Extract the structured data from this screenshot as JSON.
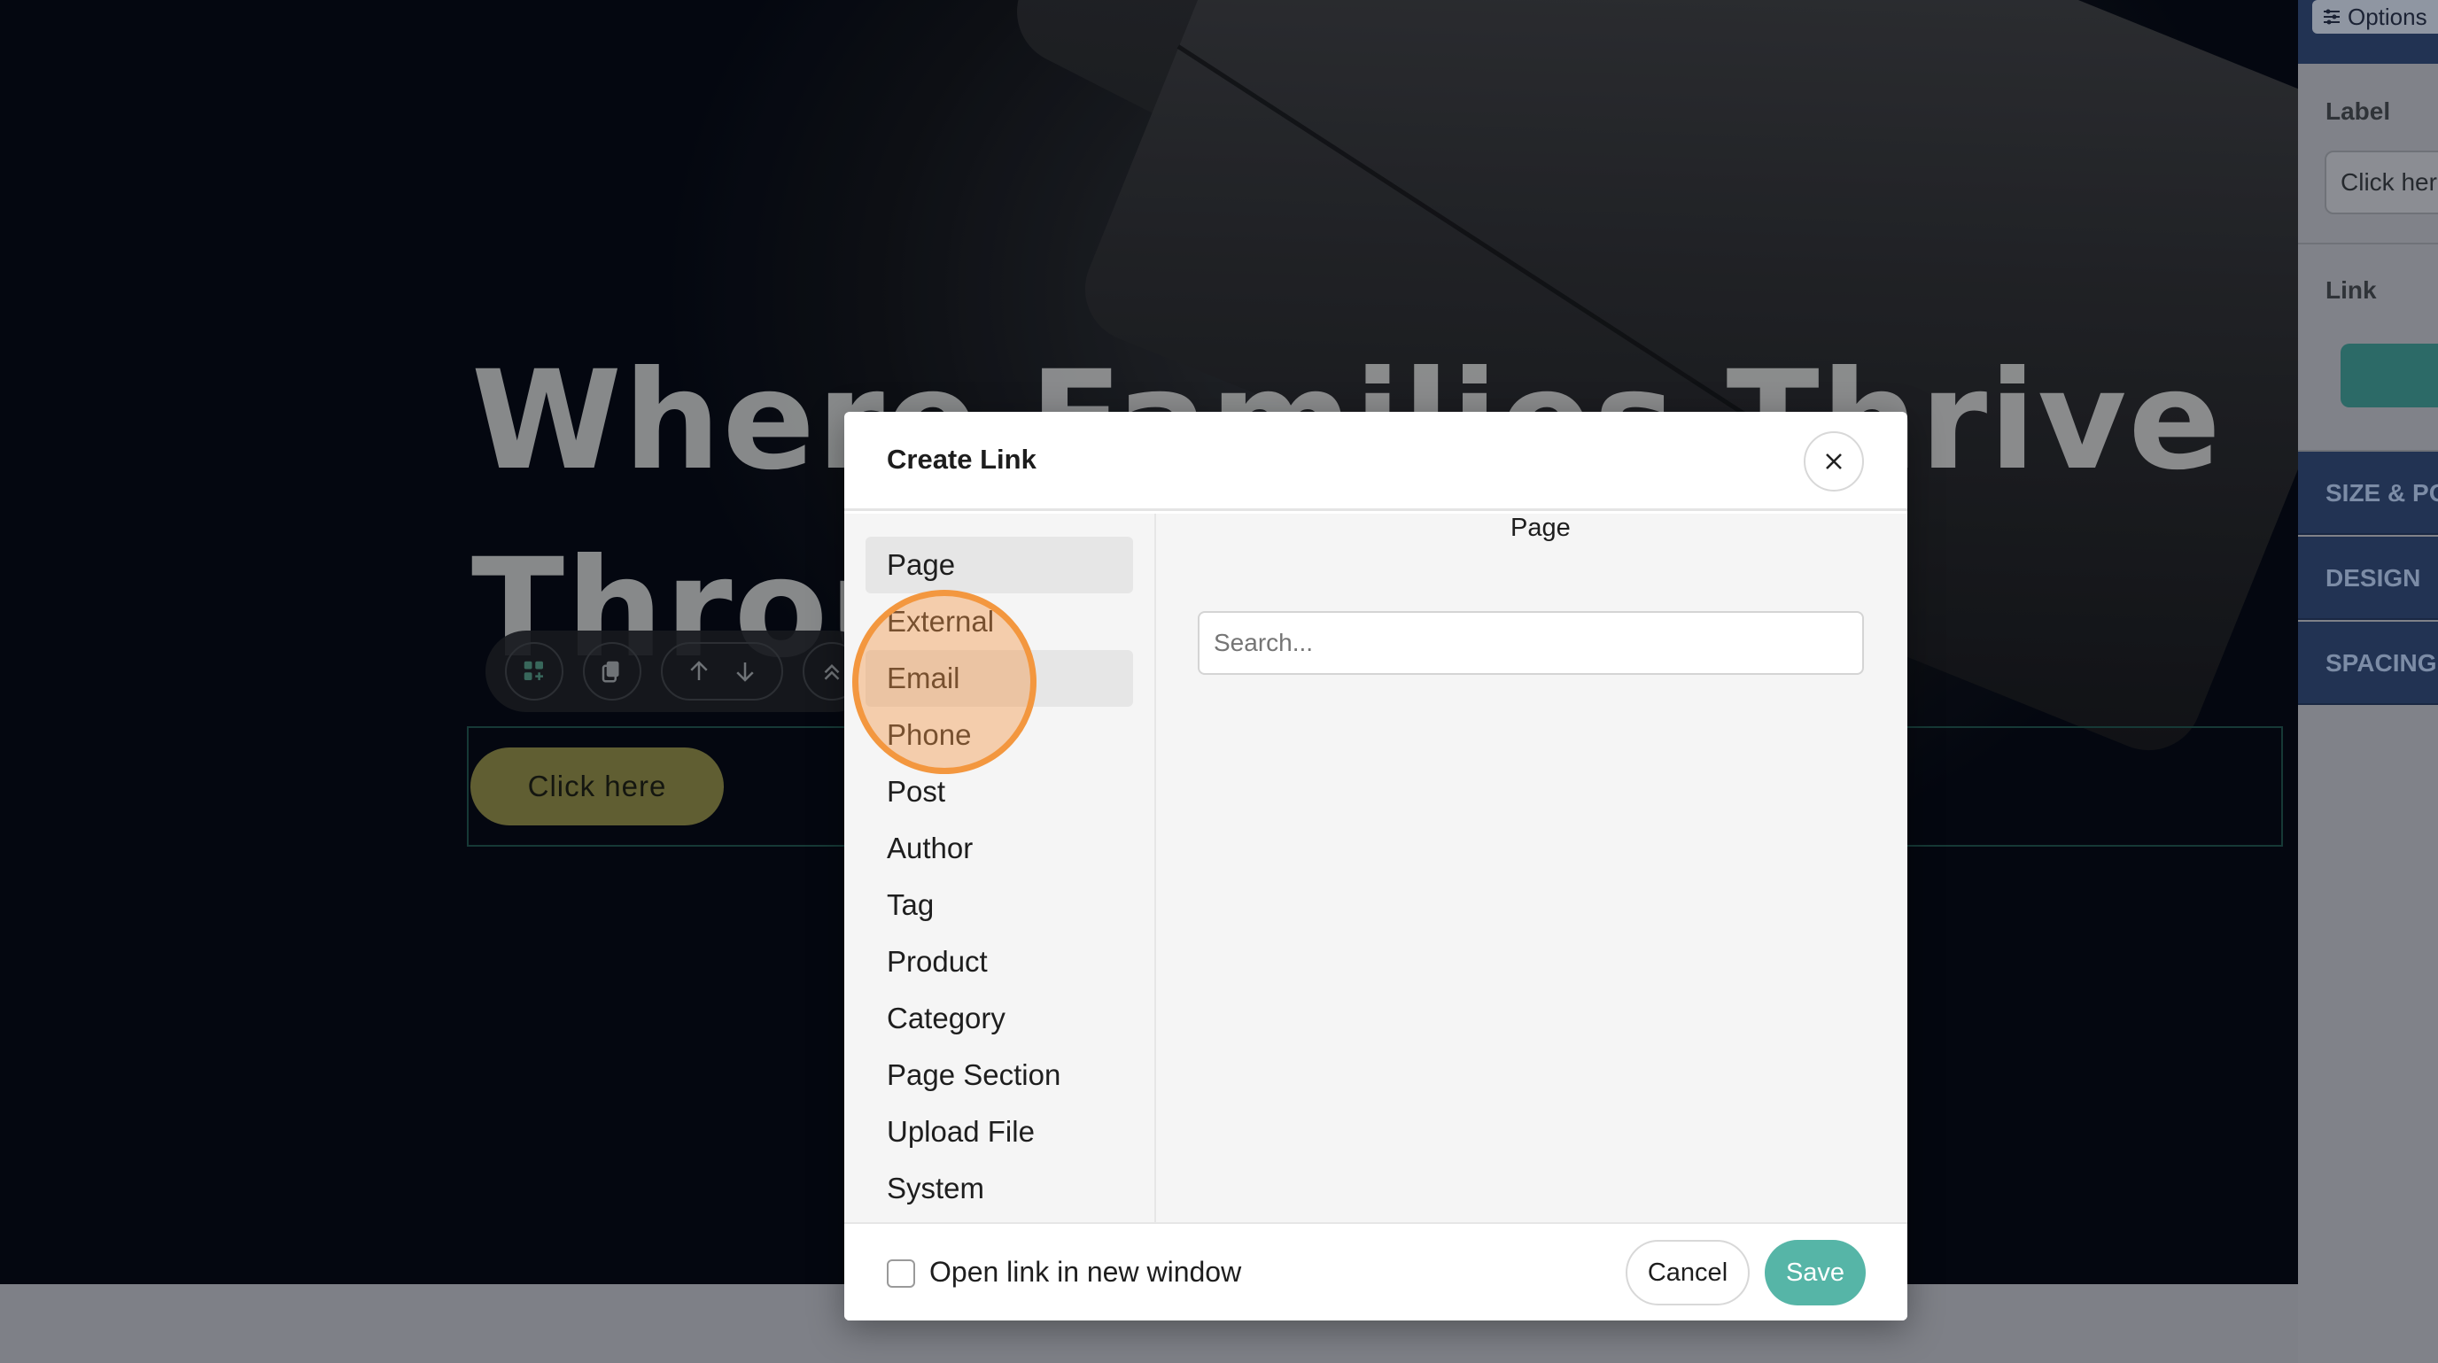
{
  "hero": {
    "title": "Where Families Thrive Through",
    "cta_label": "Click here"
  },
  "inspector": {
    "options_label": "Options",
    "label_heading": "Label",
    "label_value": "Click here",
    "link_heading": "Link",
    "sections": [
      "SIZE & POSITION",
      "DESIGN",
      "SPACING"
    ]
  },
  "modal": {
    "title": "Create Link",
    "types": [
      "Page",
      "External",
      "Email",
      "Phone",
      "Post",
      "Author",
      "Tag",
      "Product",
      "Category",
      "Page Section",
      "Upload File",
      "System"
    ],
    "active_type": "Page",
    "hovered_type": "Email",
    "pane_label": "Page",
    "search_placeholder": "Search...",
    "new_window_label": "Open link in new window",
    "cancel_label": "Cancel",
    "save_label": "Save"
  },
  "colors": {
    "save_accent": "#56b5a7",
    "cta_olive": "#868346",
    "inspector_section": "#223353",
    "click_highlight": "#f3973f"
  }
}
